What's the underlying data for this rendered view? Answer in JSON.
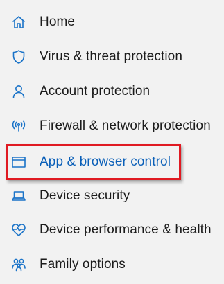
{
  "accent_color": "#1a73c8",
  "highlight_color": "#e01a22",
  "nav": {
    "items": [
      {
        "label": "Home",
        "icon": "home-icon"
      },
      {
        "label": "Virus & threat protection",
        "icon": "shield-icon"
      },
      {
        "label": "Account protection",
        "icon": "person-icon"
      },
      {
        "label": "Firewall & network protection",
        "icon": "wireless-antenna-icon"
      },
      {
        "label": "App & browser control",
        "icon": "browser-window-icon",
        "selected": true
      },
      {
        "label": "Device security",
        "icon": "laptop-icon"
      },
      {
        "label": "Device performance & health",
        "icon": "heart-pulse-icon"
      },
      {
        "label": "Family options",
        "icon": "family-icon"
      }
    ]
  }
}
